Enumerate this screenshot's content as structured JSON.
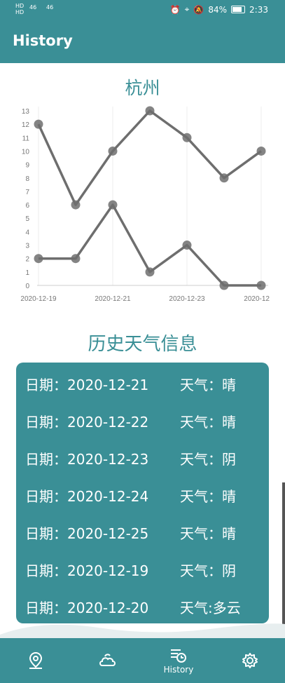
{
  "status_bar": {
    "left_top": "HD",
    "left_bottom": "HD",
    "signal1": "46",
    "signal2": "46",
    "battery": "84%",
    "time": "2:33"
  },
  "app_bar": {
    "title": "History"
  },
  "city": "杭州",
  "chart_data": {
    "type": "line",
    "x": [
      "2020-12-19",
      "2020-12-20",
      "2020-12-21",
      "2020-12-22",
      "2020-12-23",
      "2020-12-24",
      "2020-12-25"
    ],
    "x_tick_labels": [
      "2020-12-19",
      "2020-12-21",
      "2020-12-23",
      "2020-12"
    ],
    "series": [
      {
        "values": [
          12,
          6,
          10,
          13,
          11,
          8,
          10
        ]
      },
      {
        "values": [
          2,
          2,
          6,
          1,
          3,
          0,
          0
        ]
      }
    ],
    "ylim": [
      0,
      13
    ],
    "y_ticks": [
      0,
      1,
      2,
      3,
      4,
      5,
      6,
      7,
      8,
      9,
      10,
      11,
      12,
      13
    ],
    "grid": "vertical",
    "line_color": "#6e6e6e"
  },
  "history_title": "历史天气信息",
  "history": [
    {
      "date": "日期：2020-12-21",
      "weather": "天气：晴"
    },
    {
      "date": "日期：2020-12-22",
      "weather": "天气：晴"
    },
    {
      "date": "日期：2020-12-23",
      "weather": "天气：阴"
    },
    {
      "date": "日期：2020-12-24",
      "weather": "天气：晴"
    },
    {
      "date": "日期：2020-12-25",
      "weather": "天气：晴"
    },
    {
      "date": "日期：2020-12-19",
      "weather": "天气：阴"
    },
    {
      "date": "日期：2020-12-20",
      "weather": "天气:多云"
    }
  ],
  "nav": [
    {
      "icon": "location-pin-icon"
    },
    {
      "icon": "weather-cloud-icon"
    },
    {
      "icon": "history-icon",
      "label": "History"
    },
    {
      "icon": "settings-gear-icon"
    }
  ],
  "colors": {
    "primary": "#3a8f96"
  }
}
